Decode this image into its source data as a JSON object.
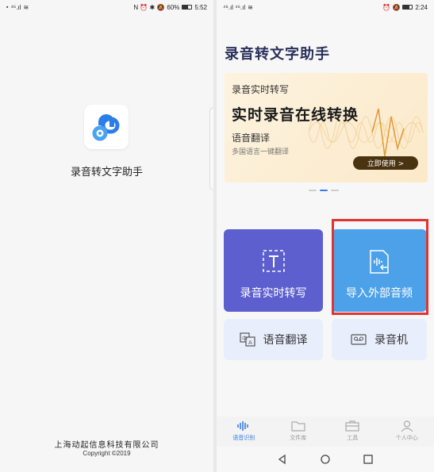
{
  "left_screen": {
    "statusbar": {
      "left": "⁴⁶.ıl",
      "right_icons": "N ⏰ ✱ 🔕",
      "battery": "60%",
      "time": "5:52",
      "battery_level": 0.6
    },
    "app_name": "录音转文字助手",
    "company": "上海动起信息科技有限公司",
    "copyright": "Copyright ©2019"
  },
  "right_screen": {
    "statusbar": {
      "left": "⁴⁶.ıl ⁴⁶.ıl",
      "right_icons": "⏰ 🔕",
      "time": "2:24",
      "battery_level": 0.7
    },
    "app_title": "录音转文字助手",
    "banner": {
      "line1": "录音实时转写",
      "headline": "实时录音在线转换",
      "line3": "语音翻译",
      "line4": "多国语言一键翻译",
      "button": "立即使用 >"
    },
    "cards": {
      "record": "录音实时转写",
      "import": "导入外部音频",
      "translate": "语音翻译",
      "recorder": "录音机"
    },
    "tabs": [
      {
        "label": "语音识别",
        "icon": "waveform-icon",
        "active": true
      },
      {
        "label": "文件库",
        "icon": "folder-icon",
        "active": false
      },
      {
        "label": "工具",
        "icon": "toolbox-icon",
        "active": false
      },
      {
        "label": "个人中心",
        "icon": "person-icon",
        "active": false
      }
    ],
    "colors": {
      "accent": "#3b7ce4",
      "record_card": "#5d5fcf",
      "import_card": "#4da1e9",
      "highlight": "#e23232",
      "banner_button": "#4a3311"
    }
  }
}
